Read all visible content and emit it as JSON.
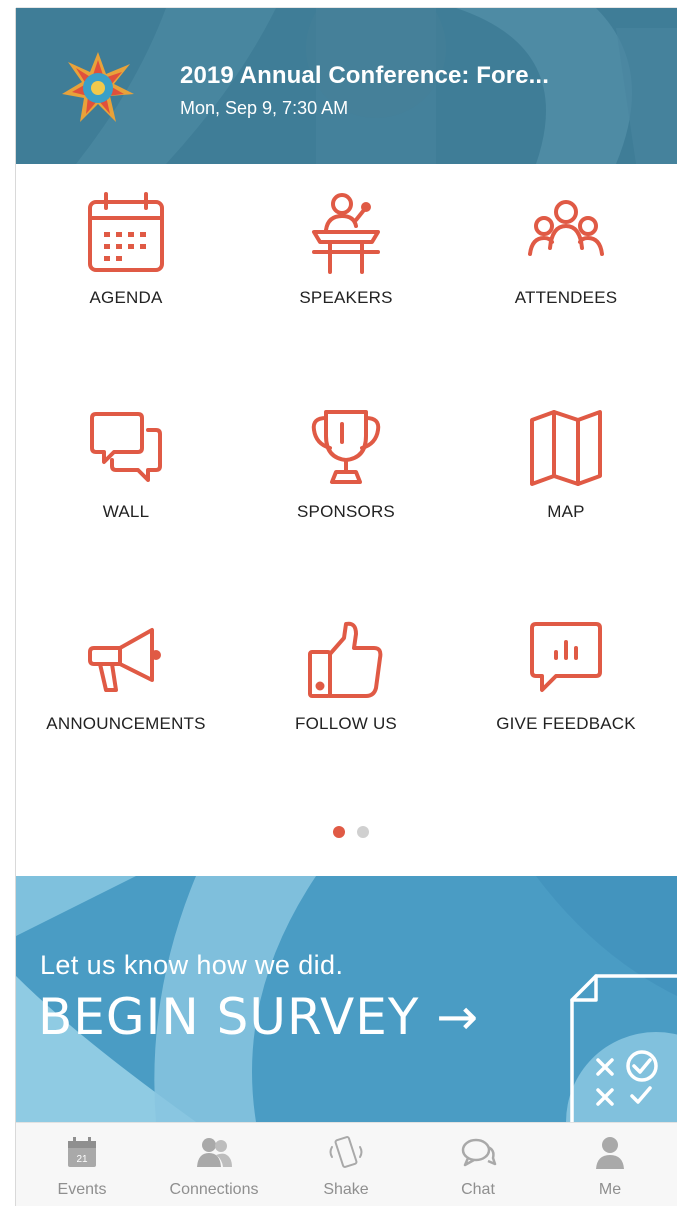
{
  "header": {
    "title": "2019 Annual Conference: Fore...",
    "datetime": "Mon, Sep 9, 7:30 AM"
  },
  "tiles": [
    {
      "label": "AGENDA",
      "icon": "calendar-icon"
    },
    {
      "label": "SPEAKERS",
      "icon": "podium-speaker-icon"
    },
    {
      "label": "ATTENDEES",
      "icon": "people-group-icon"
    },
    {
      "label": "WALL",
      "icon": "chat-bubbles-icon"
    },
    {
      "label": "SPONSORS",
      "icon": "trophy-icon"
    },
    {
      "label": "MAP",
      "icon": "folded-map-icon"
    },
    {
      "label": "ANNOUNCEMENTS",
      "icon": "megaphone-icon"
    },
    {
      "label": "FOLLOW US",
      "icon": "thumbs-up-icon"
    },
    {
      "label": "GIVE FEEDBACK",
      "icon": "feedback-chart-bubble-icon"
    }
  ],
  "pager": {
    "pages": 2,
    "current": 1
  },
  "banner": {
    "subtitle": "Let us know how we did.",
    "cta": "BEGIN SURVEY →"
  },
  "tabbar": [
    {
      "label": "Events",
      "icon": "calendar-21-icon",
      "badge": "21"
    },
    {
      "label": "Connections",
      "icon": "connections-people-icon"
    },
    {
      "label": "Shake",
      "icon": "phone-shake-icon"
    },
    {
      "label": "Chat",
      "icon": "chat-icon"
    },
    {
      "label": "Me",
      "icon": "person-icon"
    }
  ],
  "colors": {
    "accent": "#e05a45",
    "header_bg": "#3f7d97",
    "banner_bg": "#4a9cc4",
    "tab_inactive": "#a9a9a9",
    "dot_inactive": "#d0d0d0"
  }
}
